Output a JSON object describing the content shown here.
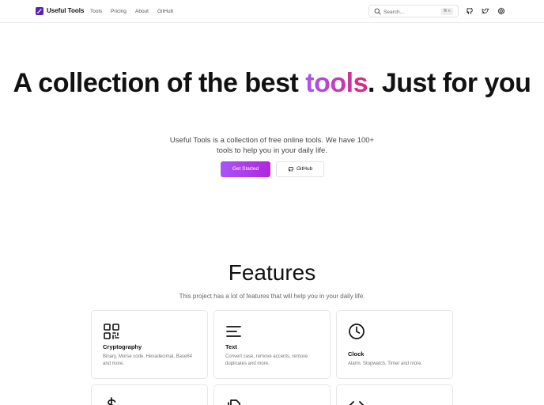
{
  "header": {
    "brand": "Useful Tools",
    "nav": [
      "Tools",
      "Pricing",
      "About",
      "GitHub"
    ],
    "search": {
      "placeholder": "Search...",
      "shortcut": "⌘ K"
    },
    "icons": [
      "github-icon",
      "twitter-icon",
      "settings-icon"
    ]
  },
  "hero": {
    "title_before": "A collection of the best ",
    "title_accent": "tools",
    "title_after": ". Just for you",
    "subtitle": "Useful Tools is a collection of free online tools. We have 100+ tools to help you in your daily life.",
    "primary_button": "Get Started",
    "secondary_button": "GitHub"
  },
  "features": {
    "title": "Features",
    "subtitle": "This project has a lot of features that will help you in your daily life.",
    "cards": [
      {
        "icon": "qr-code-icon",
        "title": "Cryptography",
        "description": "Binary, Morse code, Hexadecimal, Base64 and more."
      },
      {
        "icon": "text-align-icon",
        "title": "Text",
        "description": "Convert case, remove accents, remove duplicates and more."
      },
      {
        "icon": "clock-icon",
        "title": "Clock",
        "description": "Alarm, Stopwatch, Timer and more."
      },
      {
        "icon": "dollar-icon",
        "title": "",
        "description": ""
      },
      {
        "icon": "files-icon",
        "title": "",
        "description": ""
      },
      {
        "icon": "code-icon",
        "title": "",
        "description": ""
      }
    ]
  },
  "colors": {
    "accent_start": "#a855f7",
    "accent_end": "#db2777",
    "logo": "#5b21b6"
  }
}
